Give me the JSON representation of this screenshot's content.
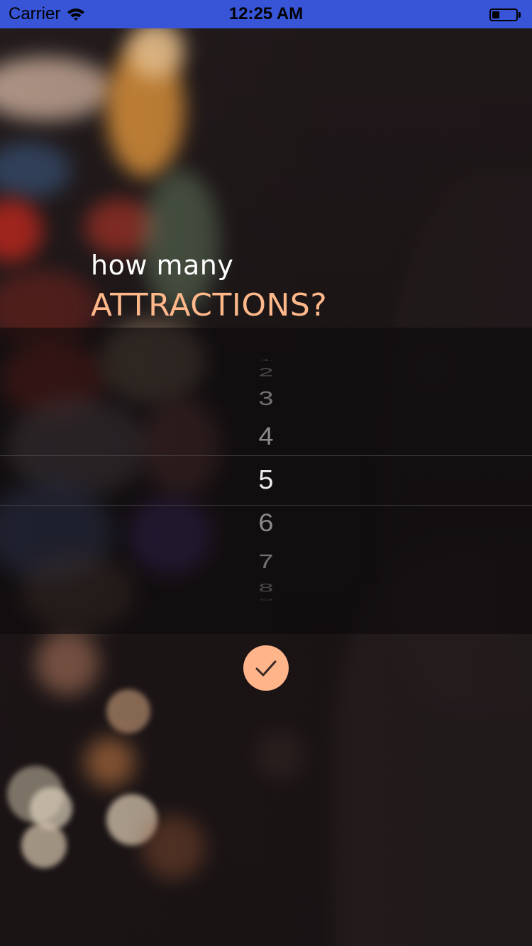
{
  "status_bar": {
    "carrier": "Carrier",
    "time": "12:25 AM",
    "battery_level": 0.3
  },
  "prompt": {
    "line1": "how many",
    "line2": "ATTRACTIONS?"
  },
  "picker": {
    "options": [
      "1",
      "2",
      "3",
      "4",
      "5",
      "6",
      "7",
      "8",
      "9"
    ],
    "selected": "5"
  },
  "confirm": {
    "icon": "check-icon"
  },
  "colors": {
    "status_bar": "#3755d6",
    "accent": "#ffb48a",
    "prompt_accent": "#ffb88a"
  }
}
